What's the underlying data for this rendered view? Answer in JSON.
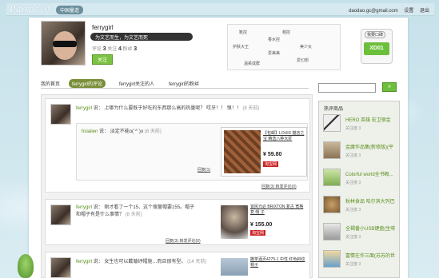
{
  "topbar": {
    "logo": "Paopao!",
    "badge": "中国量造",
    "email": "daodao.gc@gmail.com",
    "settings": "设置",
    "logout": "退出"
  },
  "profile": {
    "username": "ferrygirl",
    "tagline": "为文艺而生，为文艺而死",
    "counts": {
      "comments_label": "评论",
      "comments": "3",
      "follow_label": "关注",
      "follow": "4",
      "fans_label": "粉丝",
      "fans": "3"
    },
    "follow_button": "关注",
    "tags": [
      "靴控",
      "帽控",
      "香水控",
      "护肤大王",
      "美少女",
      "爱美美",
      "温柔成群",
      "爱幻想"
    ],
    "xd_label": "我要口碑",
    "xd_value": "XD01"
  },
  "tabs": [
    "我的首页",
    "ferrygirl的评论",
    "ferrygirl关注的人",
    "ferrygirl的粉丝"
  ],
  "search": {
    "placeholder": "",
    "button": "»"
  },
  "feed": [
    {
      "author": "ferrygirl",
      "said": "说：",
      "text": "上哪为什么要既于好吃的东西那么高的热量呢？ 哎牙！！ 恨！！",
      "time": "(8 天前)",
      "reply": {
        "author": "hsiaiien",
        "said": "说：",
        "text": "淡定不能o(´^`)o",
        "time": "(8 天前)",
        "link": "回复(1)"
      },
      "product": {
        "name": "【包邮】LOUIS 猫店之宝 精选八种大虾",
        "price": "¥ 59.80",
        "shop": "淘宝网"
      },
      "links": "回复(3) 转发评论(0)"
    },
    {
      "author": "ferrygirl",
      "said": "说：",
      "text": "刚才看了一个15、这个搜量帽要155。帽子和帽子有是什么事情？",
      "time": "(8 天前)",
      "product": {
        "name": "宜民元必 BRIXTON 复古 宽格复 帽 子",
        "price": "¥ 155.00",
        "shop": "淘宝网"
      },
      "links": "回复(3) 转发评论(0)"
    },
    {
      "author": "ferrygirl",
      "said": "说：",
      "text": "女生也可以戴皱纾帽施…而且很有型。",
      "time": "(14 天前)",
      "product": {
        "name": "撒茶酒页4275-1 中性 红色斜纹 帽子",
        "price": "",
        "shop": ""
      },
      "links": ""
    }
  ],
  "sidebar": {
    "title": "热评商品",
    "items": [
      {
        "name": "HERO 英雄 宏卫钢金",
        "count": "关注度 3"
      },
      {
        "name": "金庸作品集(新修版)(平",
        "count": "关注度 3"
      },
      {
        "name": "Colorful world全书概...",
        "count": "关注度 3"
      },
      {
        "name": "秋林食品 哈尔滨大列巴",
        "count": "关注度 3"
      },
      {
        "name": "全褐番小USB键盘(生啡",
        "count": "关注度 3"
      },
      {
        "name": "富情在作三面(苏苏的世",
        "count": "关注度 3"
      }
    ]
  },
  "colors": {
    "accent": "#6cbf3a",
    "link": "#5a8f1c",
    "background": "#cfe6ee"
  }
}
